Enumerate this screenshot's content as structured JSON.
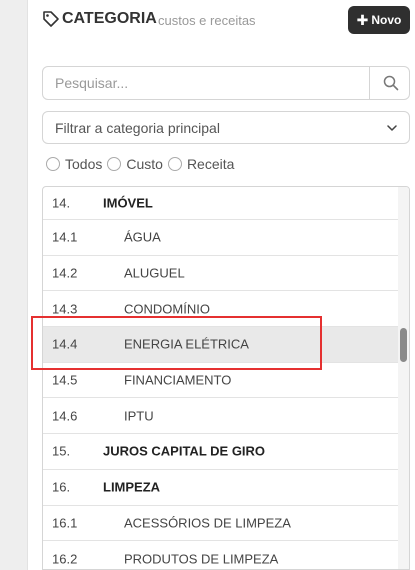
{
  "header": {
    "title": "CATEGORIA",
    "subtitle": "custos e receitas",
    "new_button_label": "Novo",
    "tag_icon": "tag-icon",
    "plus_icon": "plus-icon"
  },
  "search": {
    "placeholder": "Pesquisar...",
    "value": "",
    "icon": "search-icon"
  },
  "category_filter": {
    "selected": "Filtrar a categoria principal",
    "icon": "chevron-down-icon"
  },
  "type_filter": {
    "options": [
      {
        "label": "Todos"
      },
      {
        "label": "Custo"
      },
      {
        "label": "Receita"
      }
    ]
  },
  "categories": {
    "rows": [
      {
        "code": "14.",
        "name": "IMÓVEL"
      },
      {
        "code": "14.1",
        "name": "ÁGUA"
      },
      {
        "code": "14.2",
        "name": "ALUGUEL"
      },
      {
        "code": "14.3",
        "name": "CONDOMÍNIO"
      },
      {
        "code": "14.4",
        "name": "ENERGIA ELÉTRICA"
      },
      {
        "code": "14.5",
        "name": "FINANCIAMENTO"
      },
      {
        "code": "14.6",
        "name": "IPTU"
      },
      {
        "code": "15.",
        "name": "JUROS CAPITAL DE GIRO"
      },
      {
        "code": "16.",
        "name": "LIMPEZA"
      },
      {
        "code": "16.1",
        "name": "ACESSÓRIOS DE LIMPEZA"
      },
      {
        "code": "16.2",
        "name": "PRODUTOS DE LIMPEZA"
      }
    ]
  },
  "colors": {
    "primary_button": "#2f2f2f",
    "selected_row": "#e9e9e9",
    "highlight_border": "#e53030"
  }
}
